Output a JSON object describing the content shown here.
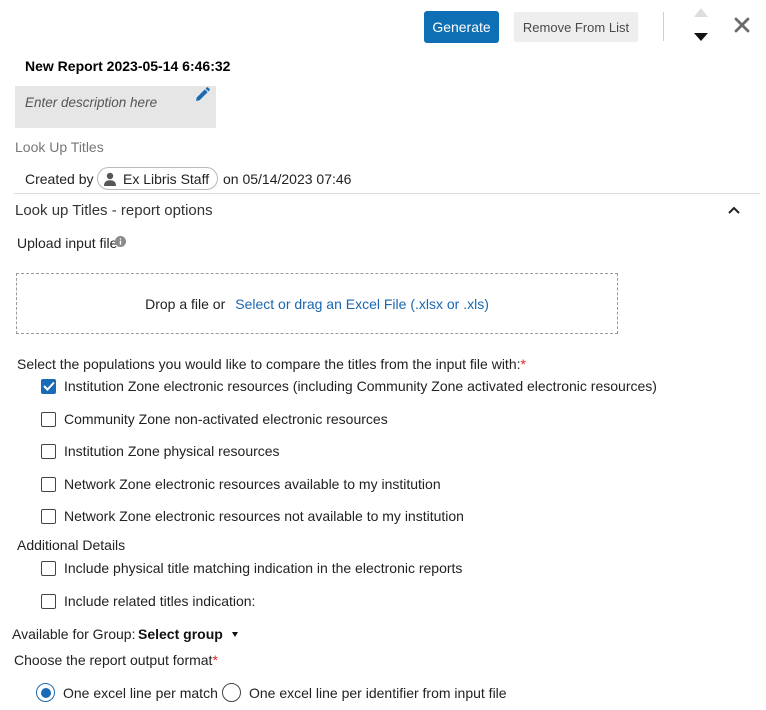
{
  "toolbar": {
    "generate_label": "Generate",
    "remove_label": "Remove From List"
  },
  "report": {
    "title": "New Report 2023-05-14 6:46:32",
    "description_placeholder": "Enter description here",
    "type_label": "Look Up Titles",
    "created_by_prefix": "Created by",
    "created_by_user": "Ex Libris Staff",
    "created_on": "on 05/14/2023 07:46"
  },
  "options": {
    "section_title": "Look up Titles - report options",
    "upload_label": "Upload input file",
    "drop_text": "Drop a file or",
    "drop_link": "Select or drag an Excel File (.xlsx or .xls)",
    "populations_label": "Select the populations you would like to compare the titles from the input file with:",
    "required_mark": "*",
    "populations": [
      {
        "label": "Institution Zone electronic resources (including Community Zone activated electronic resources)",
        "checked": true
      },
      {
        "label": "Community Zone non-activated electronic resources",
        "checked": false
      },
      {
        "label": "Institution Zone physical resources",
        "checked": false
      },
      {
        "label": "Network Zone electronic resources available to my institution",
        "checked": false
      },
      {
        "label": "Network Zone electronic resources not available to my institution",
        "checked": false
      }
    ],
    "additional_details_label": "Additional Details",
    "additional": [
      {
        "label": "Include physical title matching indication in the electronic reports",
        "checked": false
      },
      {
        "label": "Include related titles indication:",
        "checked": false
      }
    ],
    "group_label": "Available for Group:",
    "group_value": "Select group",
    "format_label": "Choose the report output format",
    "formats": [
      {
        "label": "One excel line per match",
        "selected": true
      },
      {
        "label": "One excel line per identifier from input file",
        "selected": false
      }
    ]
  },
  "colors": {
    "primary": "#0f6fb5",
    "link": "#1a67b0",
    "required": "#e22222"
  }
}
